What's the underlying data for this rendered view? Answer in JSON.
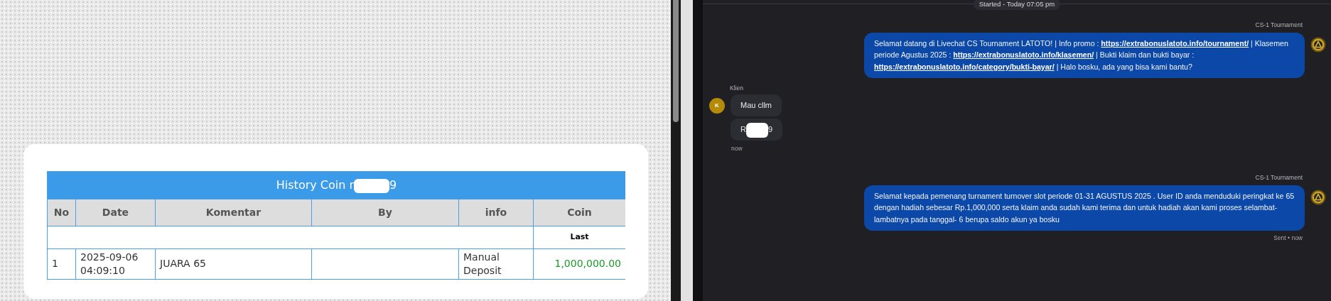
{
  "history": {
    "title_start": "History Coin r",
    "redacted": true,
    "title_end": "9",
    "columns": [
      "No",
      "Date",
      "Komentar",
      "By",
      "info",
      "Coin"
    ],
    "subheader": "Last",
    "rows": [
      {
        "no": "1",
        "date": "2025-09-06 04:09:10",
        "komentar": "JUARA 65",
        "info": "Manual Deposit",
        "coin": "1,000,000.00"
      }
    ]
  },
  "chat": {
    "started": "Started - Today 07:05 pm",
    "messages": [
      {
        "kind": "agent",
        "sender": "CS-1 Tournament",
        "segments": [
          {
            "text": "Selamat datang di Livechat CS Tournament LATOTO! | Info promo : ",
            "link": false
          },
          {
            "text": "https://extrabonuslatoto.info/tournament/",
            "link": true
          },
          {
            "text": " | Klasemen periode Agustus 2025 : ",
            "link": false
          },
          {
            "text": "https://extrabonuslatoto.info/klasemen/",
            "link": true
          },
          {
            "text": " | Bukti klaim dan bukti bayar : ",
            "link": false
          },
          {
            "text": "https://extrabonuslatoto.info/category/bukti-bayar/",
            "link": true
          },
          {
            "text": " | Halo bosku, ada yang bisa kami bantu?",
            "link": false
          }
        ]
      },
      {
        "kind": "client",
        "sender": "Klien",
        "avatar": "K",
        "bubbles": [
          {
            "text_start": "Mau cllm",
            "redacted": false
          },
          {
            "text_start": "R",
            "redacted": true,
            "text_end": "9"
          }
        ],
        "time": "now"
      },
      {
        "kind": "agent",
        "sender": "CS-1 Tournament",
        "segments": [
          {
            "text": "Selamat kepada pemenang turnament turnover slot periode 01-31 AGUSTUS 2025 . User ID anda menduduki peringkat ke 65 dengan hadiah sebesar Rp.1,000,000 serta klaim anda sudah kami terima dan untuk hadiah akan kami proses selambat-lambatnya pada tanggal- 6 berupa saldo akun ya bosku",
            "link": false
          }
        ],
        "status": "Sent • now"
      }
    ]
  }
}
